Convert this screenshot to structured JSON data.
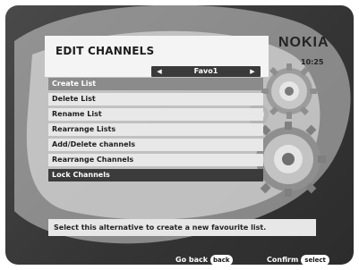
{
  "header": {
    "title": "EDIT CHANNELS",
    "brand": "NOKIA",
    "clock": "10:25"
  },
  "selector": {
    "value": "Favo1",
    "left_arrow": "◀",
    "right_arrow": "▶"
  },
  "menu": {
    "items": [
      {
        "label": "Create List"
      },
      {
        "label": "Delete List"
      },
      {
        "label": "Rename List"
      },
      {
        "label": "Rearrange Lists"
      },
      {
        "label": "Add/Delete channels"
      },
      {
        "label": "Rearrange Channels"
      },
      {
        "label": "Lock Channels"
      }
    ],
    "selected_index": 0
  },
  "help": {
    "text": "Select this alternative to create a new favourite list."
  },
  "footer": {
    "back_label": "Go back",
    "back_key": "back",
    "confirm_label": "Confirm",
    "confirm_key": "select"
  }
}
